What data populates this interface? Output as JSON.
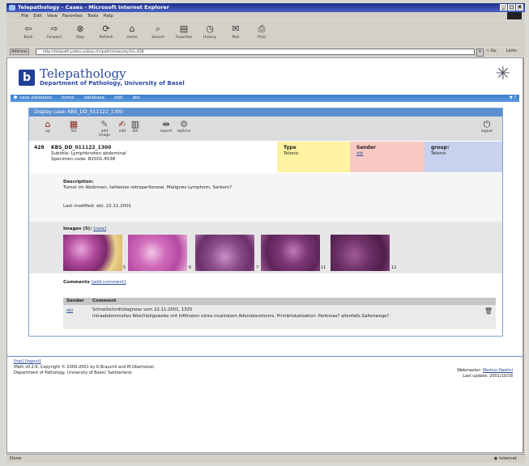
{
  "window": {
    "title": "Telepathology - Cases - Microsoft Internet Explorer",
    "controls": [
      "_",
      "□",
      "x"
    ]
  },
  "menu": [
    "File",
    "Edit",
    "View",
    "Favorites",
    "Tools",
    "Help"
  ],
  "toolbar": [
    {
      "label": "Back",
      "icon": "back-arrow-icon"
    },
    {
      "label": "Forward",
      "icon": "forward-arrow-icon"
    },
    {
      "label": "Stop",
      "icon": "stop-icon"
    },
    {
      "label": "Refresh",
      "icon": "refresh-icon"
    },
    {
      "label": "Home",
      "icon": "home-icon"
    },
    {
      "label": "Search",
      "icon": "search-icon"
    },
    {
      "label": "Favorites",
      "icon": "favorites-icon"
    },
    {
      "label": "History",
      "icon": "history-icon"
    },
    {
      "label": "Mail",
      "icon": "mail-icon"
    },
    {
      "label": "Print",
      "icon": "print-icon"
    }
  ],
  "address": {
    "label": "Address",
    "url": "http://telepath.patho.unibas.ch/ipath/show.php?id=428",
    "go": "Go",
    "links": "Links"
  },
  "site": {
    "title": "Telepathology",
    "subtitle": "Department of Pathology, University of Basel"
  },
  "nav": {
    "items": [
      "case database",
      "home",
      "database",
      "edit",
      "doc"
    ],
    "right": "▼ ?"
  },
  "case": {
    "header": "Display case: KBS_DD_011122_1300",
    "tools": [
      {
        "label": "up",
        "icon": "home-up-icon"
      },
      {
        "label": "list",
        "icon": "list-icon"
      },
      {
        "label": "add image",
        "icon": "add-image-icon"
      },
      {
        "label": "edit",
        "icon": "edit-icon"
      },
      {
        "label": "del",
        "icon": "delete-icon"
      },
      {
        "label": "export",
        "icon": "export-icon"
      },
      {
        "label": "options",
        "icon": "options-icon"
      }
    ],
    "logout": "logout",
    "number": "428",
    "id": "KBS_DD_011122_1300",
    "subtitle": "Subtitle: Lymphknoten abdominal",
    "specimen": "Specimen code: B2001.4538",
    "type_label": "Type",
    "type_value": "Telenic",
    "sender_label": "Sender",
    "sender_value": "obi",
    "group_label": "group:",
    "group_value": "Telenic",
    "description_label": "Description:",
    "description": "Tumor im Abdomen, teilweise retroperitoneal. Malignes Lymphom, Sarkom?",
    "last_modified": "Last modified: obi, 22.11.2001",
    "images_label": "Images (5):",
    "images_new": "[new]",
    "images": [
      {
        "num": "5"
      },
      {
        "num": "6"
      },
      {
        "num": "7"
      },
      {
        "num": "11"
      },
      {
        "num": "12"
      }
    ],
    "comments_label": "Comments",
    "comments_add": "[add comment]",
    "comment_headers": [
      "Sender",
      "Comment"
    ],
    "comment": {
      "sender": "obi",
      "line1": "Schnellschnittdiagnose vom 22.11.2001, 1325",
      "line2": "Intraabdominelles Weichteilgewebe mit Infiltraten eines muzinösen Adenokarzinoms. Primärlokalisation: Pankreas? allenfalls Gallenwege?"
    }
  },
  "footer": {
    "links": "[top] [logout]",
    "line1": "iPath v0.2.6, Copyright © 2000-2001 by K.Brauchli and M.Oberholzer,",
    "line2": "Department of Pathology, University of Basel, Switzerland.",
    "webmaster_label": "Webmaster:",
    "webmaster_name": "Markus Haehni",
    "last_update": "Last update: 2001/10/18"
  },
  "status": {
    "left": "Done",
    "right": "Internet"
  }
}
